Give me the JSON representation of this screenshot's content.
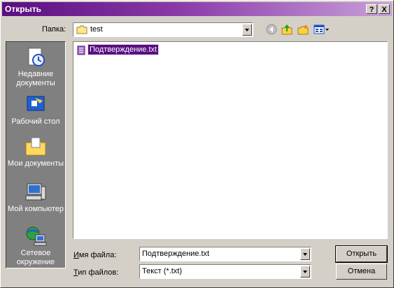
{
  "window": {
    "title": "Открыть"
  },
  "titlebar_buttons": {
    "help": "?",
    "close": "X"
  },
  "lookin": {
    "label": "Папка:",
    "value": "test"
  },
  "places": [
    {
      "label": "Недавние документы",
      "icon": "recent-documents-icon"
    },
    {
      "label": "Рабочий стол",
      "icon": "desktop-icon"
    },
    {
      "label": "Мои документы",
      "icon": "my-documents-icon"
    },
    {
      "label": "Мой компьютер",
      "icon": "my-computer-icon"
    },
    {
      "label": "Сетевое окружение",
      "icon": "network-icon"
    }
  ],
  "files": [
    {
      "name": "Подтверждение.txt",
      "selected": true
    }
  ],
  "filename": {
    "label": "Имя файла:",
    "value": "Подтверждение.txt"
  },
  "filetype": {
    "label": "Тип файлов:",
    "value": "Текст (*.txt)"
  },
  "buttons": {
    "open": "Открыть",
    "cancel": "Отмена"
  },
  "colors": {
    "accent": "#5a0e80",
    "face": "#d4d0c8",
    "sidebar": "#808080"
  }
}
